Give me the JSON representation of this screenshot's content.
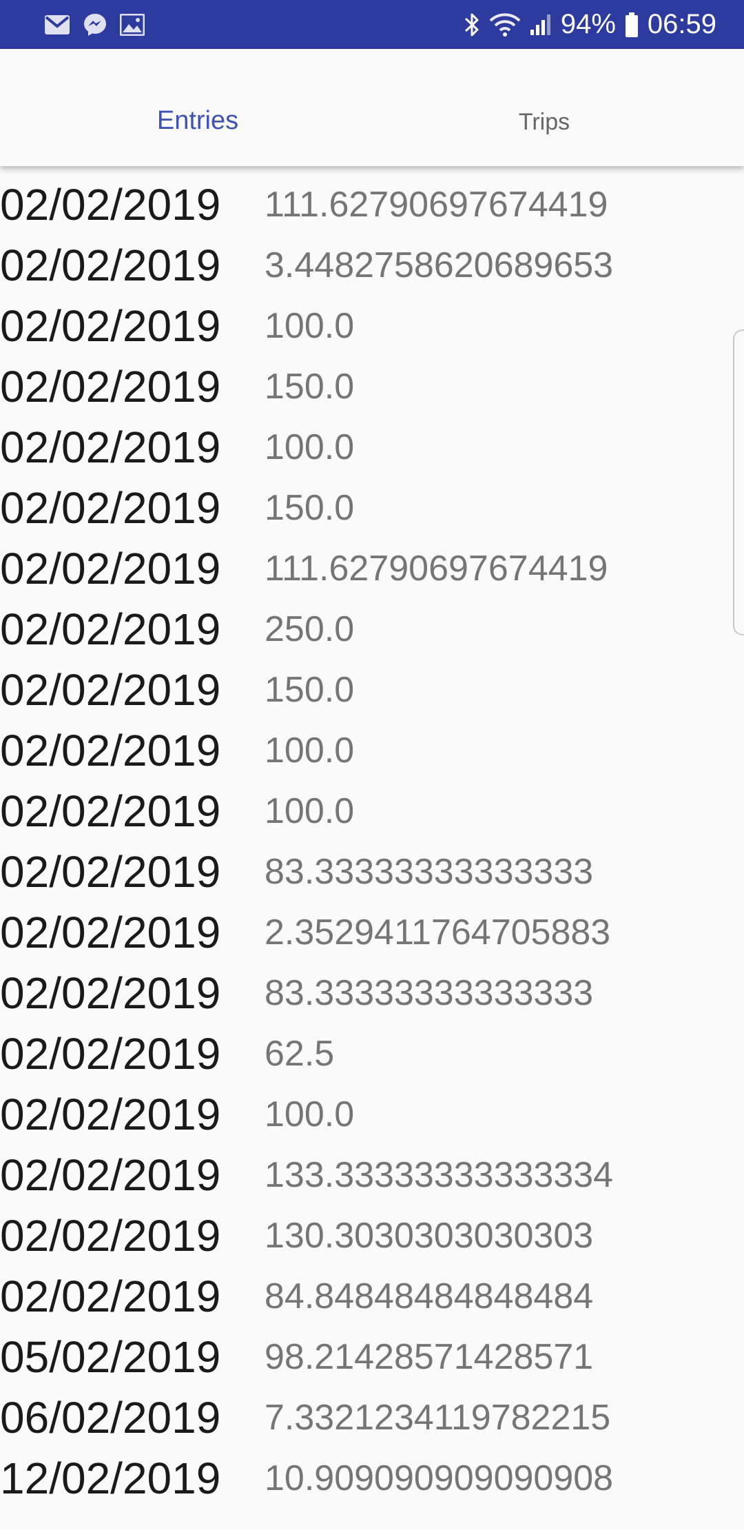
{
  "status_bar": {
    "icons_left": [
      "gmail-icon",
      "messenger-icon",
      "gallery-icon"
    ],
    "icons_right": [
      "bluetooth-icon",
      "wifi-icon",
      "cell-signal-icon",
      "battery-icon"
    ],
    "battery": "94%",
    "time": "06:59"
  },
  "tabs": [
    {
      "label": "Entries",
      "selected": true
    },
    {
      "label": "Trips",
      "selected": false
    }
  ],
  "colors": {
    "status_bar": "#2d3a9e",
    "tab_selected": "#3f51b5",
    "tab_unselected": "#666666",
    "background": "#fafafa"
  },
  "entries": [
    {
      "date": "02/02/2019",
      "value": "111.62790697674419"
    },
    {
      "date": "02/02/2019",
      "value": "3.4482758620689653"
    },
    {
      "date": "02/02/2019",
      "value": "100.0"
    },
    {
      "date": "02/02/2019",
      "value": "150.0"
    },
    {
      "date": "02/02/2019",
      "value": "100.0"
    },
    {
      "date": "02/02/2019",
      "value": "150.0"
    },
    {
      "date": "02/02/2019",
      "value": "111.62790697674419"
    },
    {
      "date": "02/02/2019",
      "value": "250.0"
    },
    {
      "date": "02/02/2019",
      "value": "150.0"
    },
    {
      "date": "02/02/2019",
      "value": "100.0"
    },
    {
      "date": "02/02/2019",
      "value": "100.0"
    },
    {
      "date": "02/02/2019",
      "value": "83.33333333333333"
    },
    {
      "date": "02/02/2019",
      "value": "2.3529411764705883"
    },
    {
      "date": "02/02/2019",
      "value": "83.33333333333333"
    },
    {
      "date": "02/02/2019",
      "value": "62.5"
    },
    {
      "date": "02/02/2019",
      "value": "100.0"
    },
    {
      "date": "02/02/2019",
      "value": "133.33333333333334"
    },
    {
      "date": "02/02/2019",
      "value": "130.3030303030303"
    },
    {
      "date": "02/02/2019",
      "value": "84.84848484848484"
    },
    {
      "date": "05/02/2019",
      "value": "98.21428571428571"
    },
    {
      "date": "06/02/2019",
      "value": "7.3321234119782215"
    },
    {
      "date": "12/02/2019",
      "value": "10.909090909090908"
    }
  ]
}
